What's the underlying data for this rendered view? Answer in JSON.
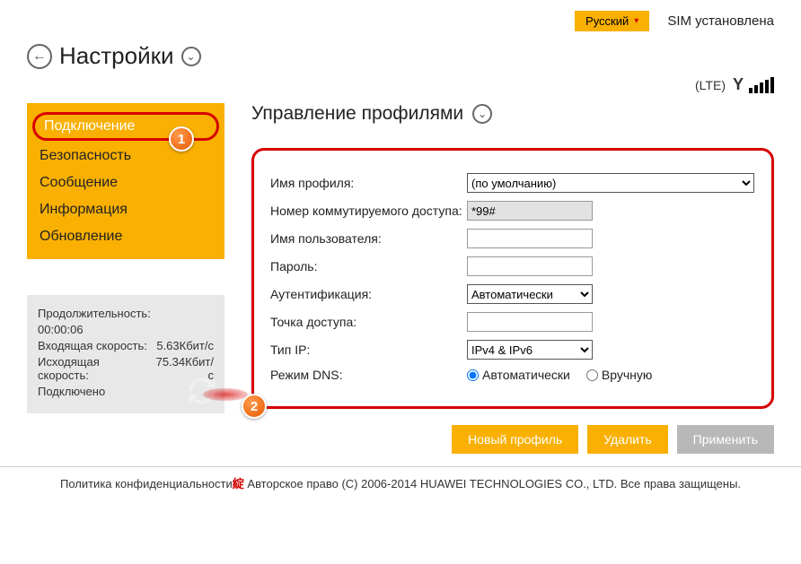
{
  "topbar": {
    "language": "Русский",
    "sim_status": "SIM установлена"
  },
  "header": {
    "title": "Настройки",
    "net_mode": "(LTE)"
  },
  "sidebar": {
    "items": [
      {
        "label": "Подключение"
      },
      {
        "label": "Безопасность"
      },
      {
        "label": "Сообщение"
      },
      {
        "label": "Информация"
      },
      {
        "label": "Обновление"
      }
    ]
  },
  "stats": {
    "duration_label": "Продолжительность:",
    "duration_value": "00:00:06",
    "in_label": "Входящая скорость:",
    "in_value": "5.63Кбит/с",
    "out_label": "Исходящая скорость:",
    "out_value": "75.34Кбит/с",
    "conn_status": "Подключено"
  },
  "main": {
    "section_title": "Управление профилями",
    "form": {
      "profile_name_label": "Имя профиля:",
      "profile_name_value": "(по умолчанию)",
      "dial_label": "Номер коммутируемого доступа:",
      "dial_value": "*99#",
      "user_label": "Имя пользователя:",
      "user_value": "",
      "pass_label": "Пароль:",
      "pass_value": "",
      "auth_label": "Аутентификация:",
      "auth_value": "Автоматически",
      "apn_label": "Точка доступа:",
      "apn_value": "",
      "ip_label": "Тип IP:",
      "ip_value": "IPv4 & IPv6",
      "dns_label": "Режим DNS:",
      "dns_auto": "Автоматически",
      "dns_manual": "Вручную"
    },
    "buttons": {
      "new": "Новый профиль",
      "delete": "Удалить",
      "apply": "Применить"
    }
  },
  "footer": {
    "privacy": "Политика конфиденциальности",
    "copyright": " Авторское право (C) 2006-2014 HUAWEI TECHNOLOGIES CO., LTD. Все права защищены."
  },
  "badges": {
    "one": "1",
    "two": "2"
  }
}
